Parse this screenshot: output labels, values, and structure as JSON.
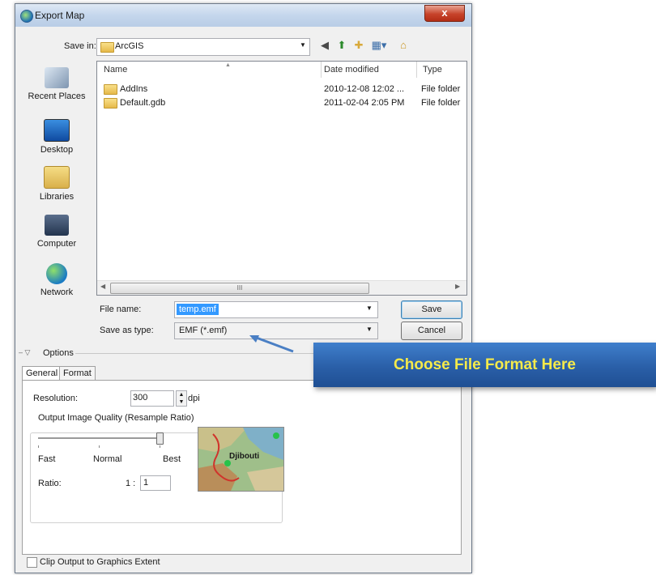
{
  "window": {
    "title": "Export Map",
    "close_glyph": "x"
  },
  "save_in": {
    "label": "Save in:",
    "value": "ArcGIS",
    "folder_icon": "folder-icon"
  },
  "toolbar": {
    "icons": [
      "back-icon",
      "up-folder-icon",
      "new-folder-icon",
      "view-menu-icon",
      "home-icon"
    ]
  },
  "places": [
    {
      "label": "Recent Places",
      "icon": "recent-places-icon"
    },
    {
      "label": "Desktop",
      "icon": "desktop-icon"
    },
    {
      "label": "Libraries",
      "icon": "libraries-icon"
    },
    {
      "label": "Computer",
      "icon": "computer-icon"
    },
    {
      "label": "Network",
      "icon": "network-icon"
    }
  ],
  "file_list": {
    "columns": [
      "Name",
      "Date modified",
      "Type"
    ],
    "rows": [
      {
        "name": "AddIns",
        "date": "2010-12-08 12:02 ...",
        "type": "File folder"
      },
      {
        "name": "Default.gdb",
        "date": "2011-02-04 2:05 PM",
        "type": "File folder"
      }
    ],
    "scroll_thumb_glyph": "III"
  },
  "file_name": {
    "label": "File name:",
    "value": "temp.emf"
  },
  "save_as_type": {
    "label": "Save as type:",
    "value": "EMF (*.emf)"
  },
  "buttons": {
    "save": "Save",
    "cancel": "Cancel"
  },
  "options": {
    "label": "Options",
    "tabs": [
      "General",
      "Format"
    ],
    "resolution": {
      "label": "Resolution:",
      "value": "300",
      "unit": "dpi"
    },
    "quality": {
      "group_label": "Output Image Quality (Resample Ratio)",
      "ticks": [
        "Fast",
        "Normal",
        "Best"
      ],
      "level": 1.0,
      "ratio_label": "Ratio:",
      "ratio_prefix": "1 :",
      "ratio_value": "1"
    },
    "preview_label": "Djibouti"
  },
  "clip": {
    "label": "Clip Output to Graphics Extent",
    "checked": false
  },
  "callout": {
    "text": "Choose File Format Here",
    "text_color": "#f5ea4a",
    "bg_color": "#2a5fa8"
  }
}
